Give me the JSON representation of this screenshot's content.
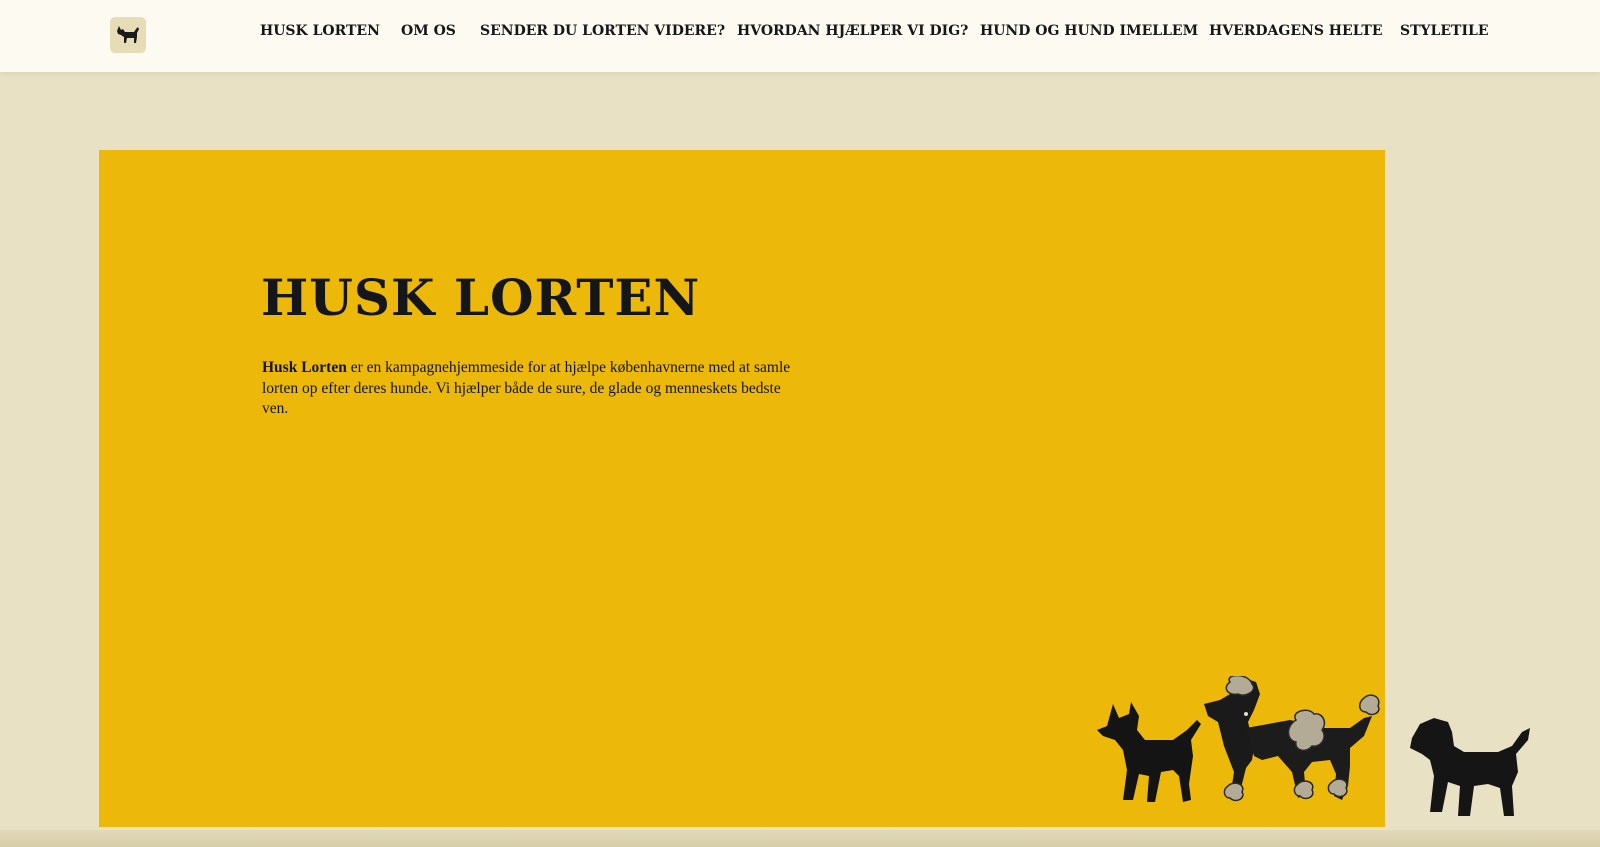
{
  "header": {
    "logo_icon": "dog-logo-icon",
    "nav": [
      {
        "label": "HUSK LORTEN"
      },
      {
        "label": "OM OS"
      },
      {
        "label": "SENDER DU LORTEN VIDERE?"
      },
      {
        "label": "HVORDAN HJÆLPER VI DIG?"
      },
      {
        "label": "HUND OG HUND IMELLEM"
      },
      {
        "label": "HVERDAGENS HELTE"
      },
      {
        "label": "STYLETILE"
      }
    ]
  },
  "hero": {
    "title": "HUSK LORTEN",
    "intro_bold": "Husk Lorten",
    "intro_rest": " er en kampagnehjemmeside for at hjælpe københavnerne med at samle lorten op efter deres hunde. Vi hjælper både de sure, de glade og menneskets bedste ven.",
    "illustrations": [
      "terrier-icon",
      "poodle-icon",
      "labrador-icon"
    ]
  },
  "colors": {
    "page_background": "#e9e1c3",
    "header_background": "#fdfbf1",
    "hero_background": "#ecb90a",
    "text": "#14161a"
  }
}
